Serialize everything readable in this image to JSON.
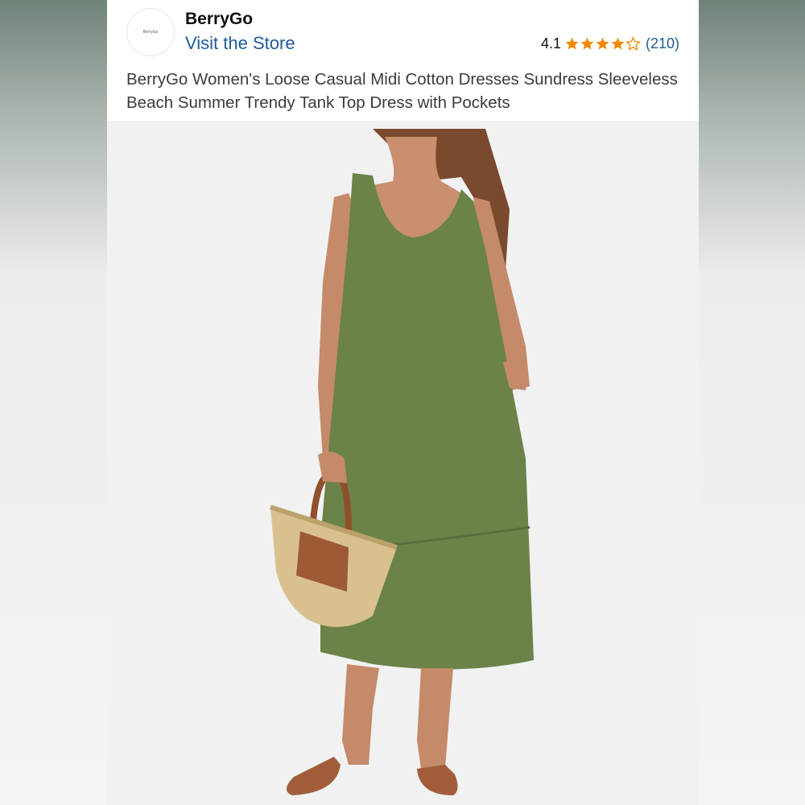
{
  "store": {
    "logo_text": "BerryGo",
    "name": "BerryGo",
    "link_label": "Visit the Store"
  },
  "rating": {
    "value": "4.1",
    "stars": 4.1,
    "count": "(210)",
    "star_color": "#f08804"
  },
  "product": {
    "title": "BerryGo Women's Loose Casual Midi Cotton Dresses Sundress Sleeveless Beach Summer Trendy Tank Top Dress with Pockets",
    "image_icon": "product-photo-green-dress",
    "dress_color": "#6b8249"
  }
}
